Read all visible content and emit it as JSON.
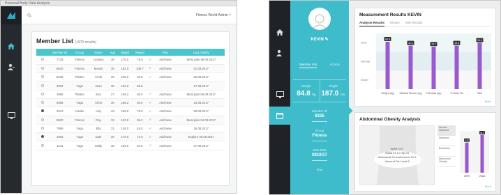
{
  "left_window": {
    "title": "Personal Body Data Analysis",
    "search_placeholder": "",
    "user_menu": "Fitness World Admin",
    "member_list": {
      "title": "Member List",
      "subtitle": "(1970 results)",
      "columns": [
        "",
        "Member ID",
        "Group",
        "Name",
        "Age",
        "Height",
        "Weight",
        "",
        "Plan",
        "Last Activity"
      ],
      "rows": [
        {
          "checked": false,
          "id": "7729",
          "group": "Fitness",
          "name": "Lindsey",
          "age": "35",
          "height": "170.0",
          "weight": "78.5",
          "plan": "Add New",
          "note": "Wrist plan",
          "date": "08.09.2017"
        },
        {
          "checked": false,
          "id": "8640",
          "group": "Fitness",
          "name": "Maxim",
          "age": "35",
          "height": "182.0",
          "weight": "108.7",
          "plan": "Add New",
          "note": "",
          "date": "01.09.2017"
        },
        {
          "checked": false,
          "id": "8239",
          "group": "Pilates",
          "name": "Cindi",
          "age": "28",
          "height": "165.2",
          "weight": "60.8",
          "plan": "Add New",
          "note": "",
          "date": "06.08.2017"
        },
        {
          "checked": false,
          "id": "3994",
          "group": "Yoga",
          "name": "Jean",
          "age": "35",
          "height": "162.6",
          "weight": "59.8",
          "plan": "",
          "note": "",
          "date": "17.08.2017"
        },
        {
          "checked": false,
          "id": "3085",
          "group": "Pilates",
          "name": "Eva",
          "age": "27",
          "height": "169.2",
          "weight": "60.0",
          "plan": "Add New",
          "note": "Meal plan",
          "date": "06.09.2017"
        },
        {
          "checked": false,
          "id": "6085",
          "group": "Yoga",
          "name": "Chris",
          "age": "36",
          "height": "168.2",
          "weight": "60.5",
          "plan": "Add New",
          "note": "",
          "date": "24.08.2017"
        },
        {
          "checked": true,
          "id": "3213",
          "group": "Cardio",
          "name": "Amy",
          "age": "49",
          "height": "155.8",
          "weight": "78.6",
          "plan": "Add New",
          "note": "",
          "date": "09.09.2017"
        },
        {
          "checked": false,
          "id": "9020",
          "group": "Fitness",
          "name": "Ray",
          "age": "32",
          "height": "182.8",
          "weight": "96.2",
          "plan": "Add New",
          "note": "Meal plan",
          "date": "04.09.2017"
        },
        {
          "checked": false,
          "id": "7869",
          "group": "Yoga",
          "name": "Elly",
          "age": "31",
          "height": "148.0",
          "weight": "45.0",
          "plan": "Add New",
          "note": "",
          "date": "18.08.2017"
        },
        {
          "checked": true,
          "id": "1093",
          "group": "Yoga",
          "name": "Kate",
          "age": "26",
          "height": "170.0",
          "weight": "72.5",
          "plan": "Add New",
          "note": "Explore",
          "date": "08.09.2017"
        },
        {
          "checked": false,
          "id": "1133",
          "group": "Yoga",
          "name": "Molly",
          "age": "38",
          "height": "155.0",
          "weight": "52.5",
          "plan": "Add New",
          "note": "",
          "date": "07.09.2017"
        }
      ]
    }
  },
  "right_window": {
    "profile": {
      "name": "KEVIN",
      "tabs": [
        "Member Info",
        "Activity"
      ],
      "weight_label": "Weight",
      "weight_value": "84.8",
      "weight_unit": "kg",
      "height_label": "Height",
      "height_value": "187.0",
      "height_unit": "cm",
      "member_id_label": "Member ID",
      "member_id": "8325",
      "group_label": "Group",
      "group": "Fitness",
      "start_label": "Start Date",
      "start_date": "0810/17",
      "end_label": "Day"
    },
    "results": {
      "title": "Measurement Results",
      "member": "KEVIN",
      "tabs": [
        "Analysis Results",
        "History",
        "Mini Results"
      ],
      "more": "More"
    },
    "abdominal": {
      "title": "Abdominal Obesity Analysis",
      "center_line1": "WHR 0.97",
      "center_line2": "Waist 91.5 / Hip 94",
      "center_line3": "Abdominal Circumference 91.5",
      "center_line4": "Visceral Fat Level 8",
      "legend": [
        "Normal Standard",
        "Standard",
        "Borderline",
        "Abdominal Obesity"
      ],
      "more": "More"
    }
  },
  "chart_data": [
    {
      "type": "bar",
      "categories": [
        "Weight (kg)",
        "Skeletal Muscle (kg)",
        "Fat Mass (kg)",
        "% Body Fat",
        "BMI"
      ],
      "values": [
        84.8,
        41.2,
        15.7,
        18.5,
        24.3
      ],
      "bar_heights_pct": [
        0.85,
        0.78,
        0.76,
        0.78,
        0.83
      ],
      "band_labels": [
        "Over",
        "Normal",
        "Under"
      ],
      "color": "#9b59d0"
    },
    {
      "type": "bar",
      "categories": [
        "WHR",
        "Waist"
      ],
      "values": [
        0.97,
        91.5
      ],
      "bar_heights_pct": [
        0.72,
        0.9
      ],
      "color": "#9b59d0"
    }
  ]
}
